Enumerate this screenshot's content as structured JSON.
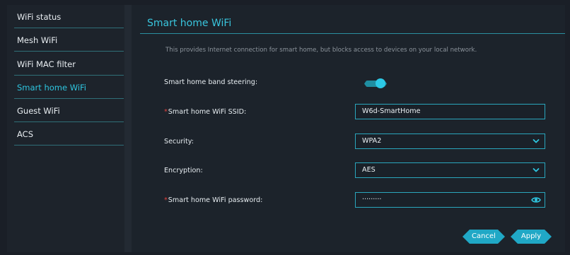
{
  "sidebar": {
    "items": [
      {
        "label": "WiFi status",
        "active": false
      },
      {
        "label": "Mesh WiFi",
        "active": false
      },
      {
        "label": "WiFi MAC filter",
        "active": false
      },
      {
        "label": "Smart home WiFi",
        "active": true
      },
      {
        "label": "Guest WiFi",
        "active": false
      },
      {
        "label": "ACS",
        "active": false
      }
    ]
  },
  "main": {
    "title": "Smart home WiFi",
    "description": "This provides Internet connection for smart home, but blocks access to devices on your local network.",
    "band_steering": {
      "label": "Smart home band steering:",
      "enabled": true
    },
    "ssid": {
      "required_mark": "*",
      "label": "Smart home WiFi SSID:",
      "value": "W6d-SmartHome"
    },
    "security": {
      "label": "Security:",
      "value": "WPA2"
    },
    "encryption": {
      "label": "Encryption:",
      "value": "AES"
    },
    "password": {
      "required_mark": "*",
      "label": "Smart home WiFi password:",
      "value": "·········"
    },
    "buttons": {
      "cancel": "Cancel",
      "apply": "Apply"
    }
  },
  "colors": {
    "accent": "#2ec6e0",
    "button": "#20a8c6",
    "required": "#e2413d",
    "background": "#1c232b"
  },
  "icons": {
    "dropdown": "chevron-down-icon",
    "password_visibility": "eye-icon"
  }
}
